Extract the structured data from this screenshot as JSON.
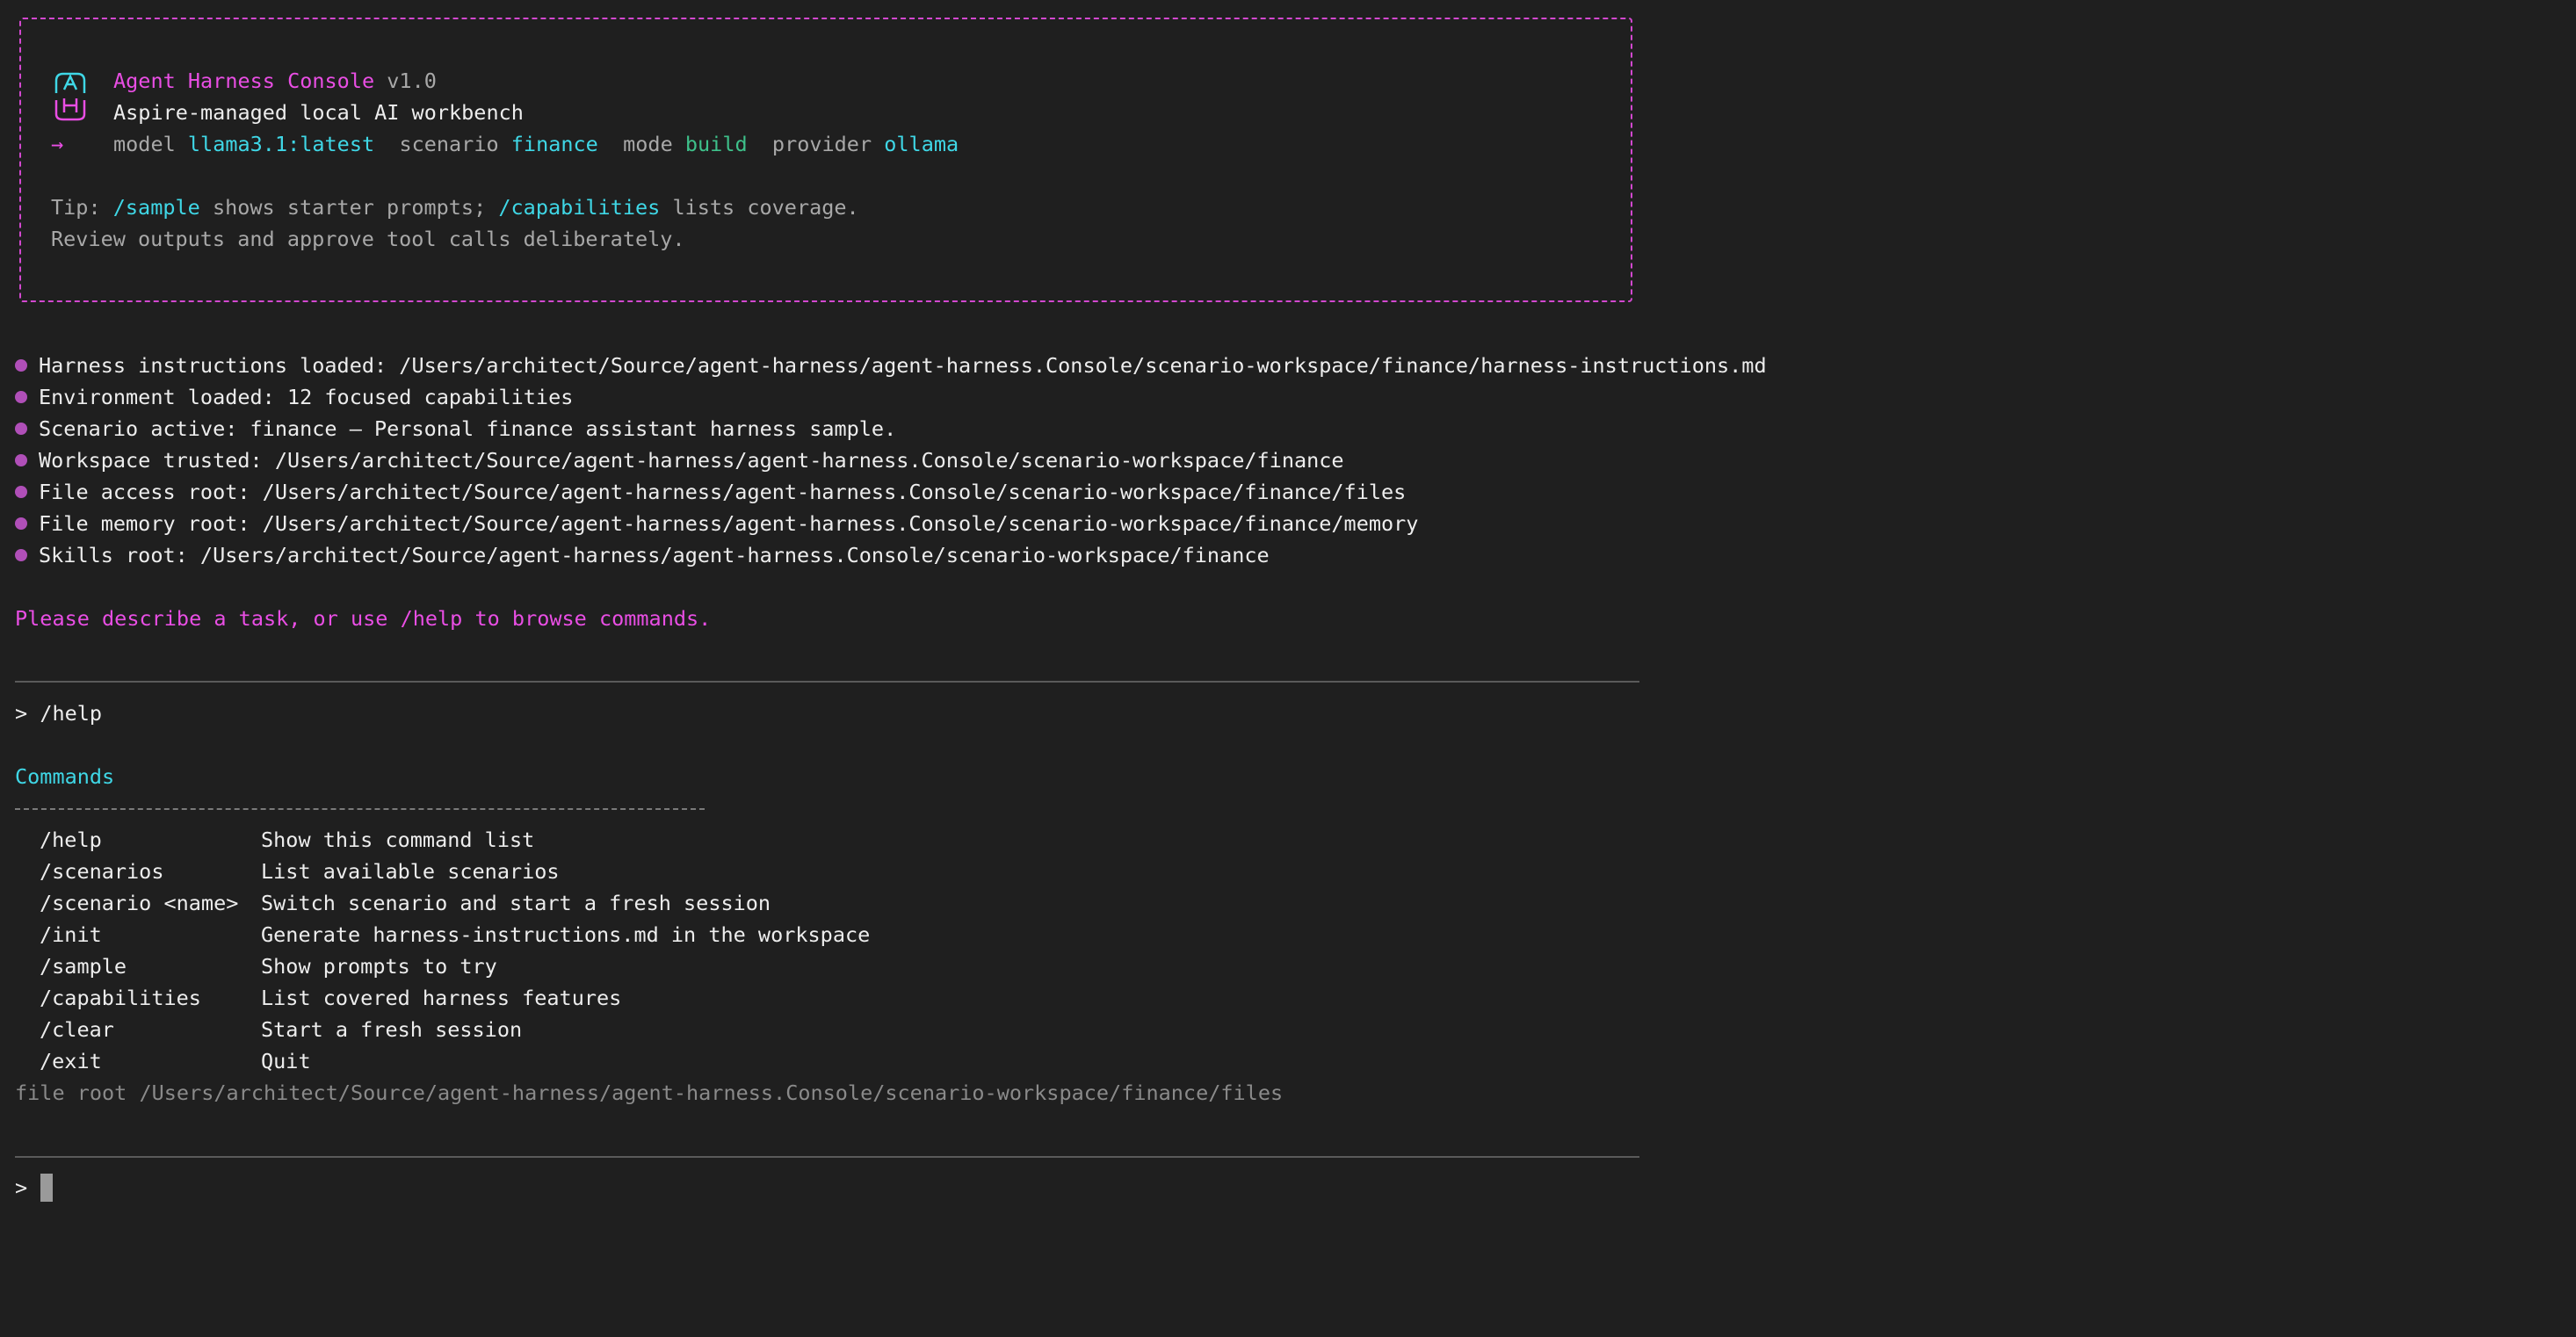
{
  "banner": {
    "title": "Agent Harness Console",
    "version": "v1.0",
    "subtitle": "Aspire-managed local AI workbench",
    "arrow": "→",
    "model_label": "model",
    "model_value": "llama3.1:latest",
    "scenario_label": "scenario",
    "scenario_value": "finance",
    "mode_label": "mode",
    "mode_value": "build",
    "provider_label": "provider",
    "provider_value": "ollama",
    "tip_prefix": "Tip:",
    "tip_cmd1": "/sample",
    "tip_mid": "shows starter prompts;",
    "tip_cmd2": "/capabilities",
    "tip_suffix": "lists coverage.",
    "review_line": "Review outputs and approve tool calls deliberately."
  },
  "status": [
    "Harness instructions loaded: /Users/architect/Source/agent-harness/agent-harness.Console/scenario-workspace/finance/harness-instructions.md",
    "Environment loaded: 12 focused capabilities",
    "Scenario active: finance – Personal finance assistant harness sample.",
    "Workspace trusted: /Users/architect/Source/agent-harness/agent-harness.Console/scenario-workspace/finance",
    "File access root: /Users/architect/Source/agent-harness/agent-harness.Console/scenario-workspace/finance/files",
    "File memory root: /Users/architect/Source/agent-harness/agent-harness.Console/scenario-workspace/finance/memory",
    "Skills root: /Users/architect/Source/agent-harness/agent-harness.Console/scenario-workspace/finance"
  ],
  "prompt_message": "Please describe a task, or use /help to browse commands.",
  "entered_command": "/help",
  "prompt_symbol": ">",
  "commands_header": "Commands",
  "commands": [
    {
      "cmd": "/help",
      "desc": "Show this command list"
    },
    {
      "cmd": "/scenarios",
      "desc": "List available scenarios"
    },
    {
      "cmd": "/scenario <name>",
      "desc": "Switch scenario and start a fresh session"
    },
    {
      "cmd": "/init",
      "desc": "Generate harness-instructions.md in the workspace"
    },
    {
      "cmd": "/sample",
      "desc": "Show prompts to try"
    },
    {
      "cmd": "/capabilities",
      "desc": "List covered harness features"
    },
    {
      "cmd": "/clear",
      "desc": "Start a fresh session"
    },
    {
      "cmd": "/exit",
      "desc": "Quit"
    }
  ],
  "file_root_line": "file root /Users/architect/Source/agent-harness/agent-harness.Console/scenario-workspace/finance/files",
  "input": {
    "prompt": ">",
    "value": ""
  },
  "colors": {
    "background": "#1f1f1f",
    "accent_magenta": "#e94ee4",
    "accent_cyan": "#3fd7e6",
    "accent_green": "#3ec08a"
  },
  "icons": {
    "logo": "ah-logo-icon",
    "bullet": "status-bullet-icon",
    "arrow": "arrow-right-icon"
  }
}
